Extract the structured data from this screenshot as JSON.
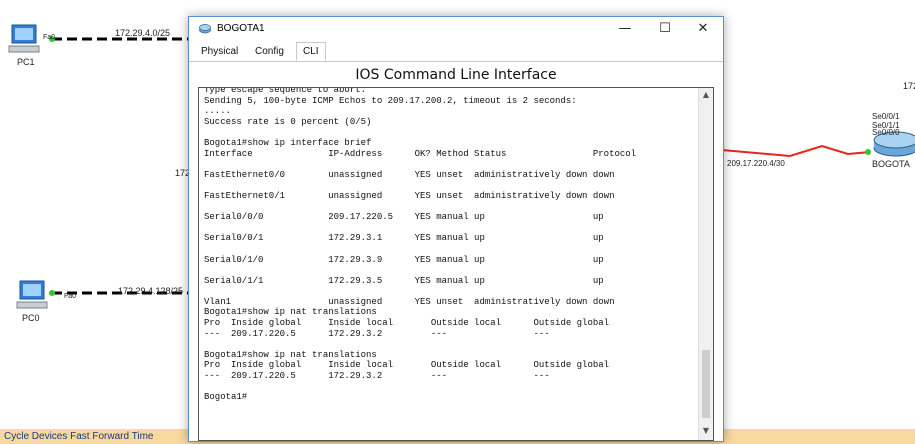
{
  "workspace": {
    "pc1_label": "PC1",
    "pc1_port": "Fa0",
    "link_top_net": "172.29.4.0/25",
    "pc0_label": "PC0",
    "pc0_port": "Fa0",
    "link_bottom_net": "172.29.4.128/25",
    "partial_left_label": "172",
    "right_net": "209.17.220.4/30",
    "router_label": "BOGOTA",
    "partial_right_label": "172",
    "port_se001": "Se0/0/1",
    "port_se011": "Se0/1/1",
    "port_se000": "Se0/0/0"
  },
  "status_bar": {
    "text": "Cycle Devices  Fast Forward Time"
  },
  "window": {
    "title": "BOGOTA1",
    "minimize": "—",
    "maximize": "☐",
    "close": "✕",
    "tabs": [
      {
        "label": "Physical"
      },
      {
        "label": "Config"
      },
      {
        "label": "CLI"
      }
    ],
    "active_tab": "CLI",
    "heading": "IOS Command Line Interface"
  },
  "terminal": {
    "lines": [
      "Type escape sequence to abort.",
      "Sending 5, 100-byte ICMP Echos to 209.17.200.2, timeout is 2 seconds:",
      ".....",
      "Success rate is 0 percent (0/5)",
      "",
      "Bogota1#show ip interface brief",
      "Interface              IP-Address      OK? Method Status                Protocol",
      "",
      "FastEthernet0/0        unassigned      YES unset  administratively down down",
      "",
      "FastEthernet0/1        unassigned      YES unset  administratively down down",
      "",
      "Serial0/0/0            209.17.220.5    YES manual up                    up",
      "",
      "Serial0/0/1            172.29.3.1      YES manual up                    up",
      "",
      "Serial0/1/0            172.29.3.9      YES manual up                    up",
      "",
      "Serial0/1/1            172.29.3.5      YES manual up                    up",
      "",
      "Vlan1                  unassigned      YES unset  administratively down down",
      "Bogota1#show ip nat translations",
      "Pro  Inside global     Inside local       Outside local      Outside global",
      "---  209.17.220.5      172.29.3.2         ---                ---",
      "",
      "Bogota1#show ip nat translations",
      "Pro  Inside global     Inside local       Outside local      Outside global",
      "---  209.17.220.5      172.29.3.2         ---                ---",
      "",
      "Bogota1#"
    ]
  },
  "colors": {
    "link_dashed": "#000000",
    "link_serial": "#e8241c",
    "link_up_dot": "#2ec62e",
    "status_bar": "#f7d9a0",
    "window_border": "#5a8fd1"
  }
}
